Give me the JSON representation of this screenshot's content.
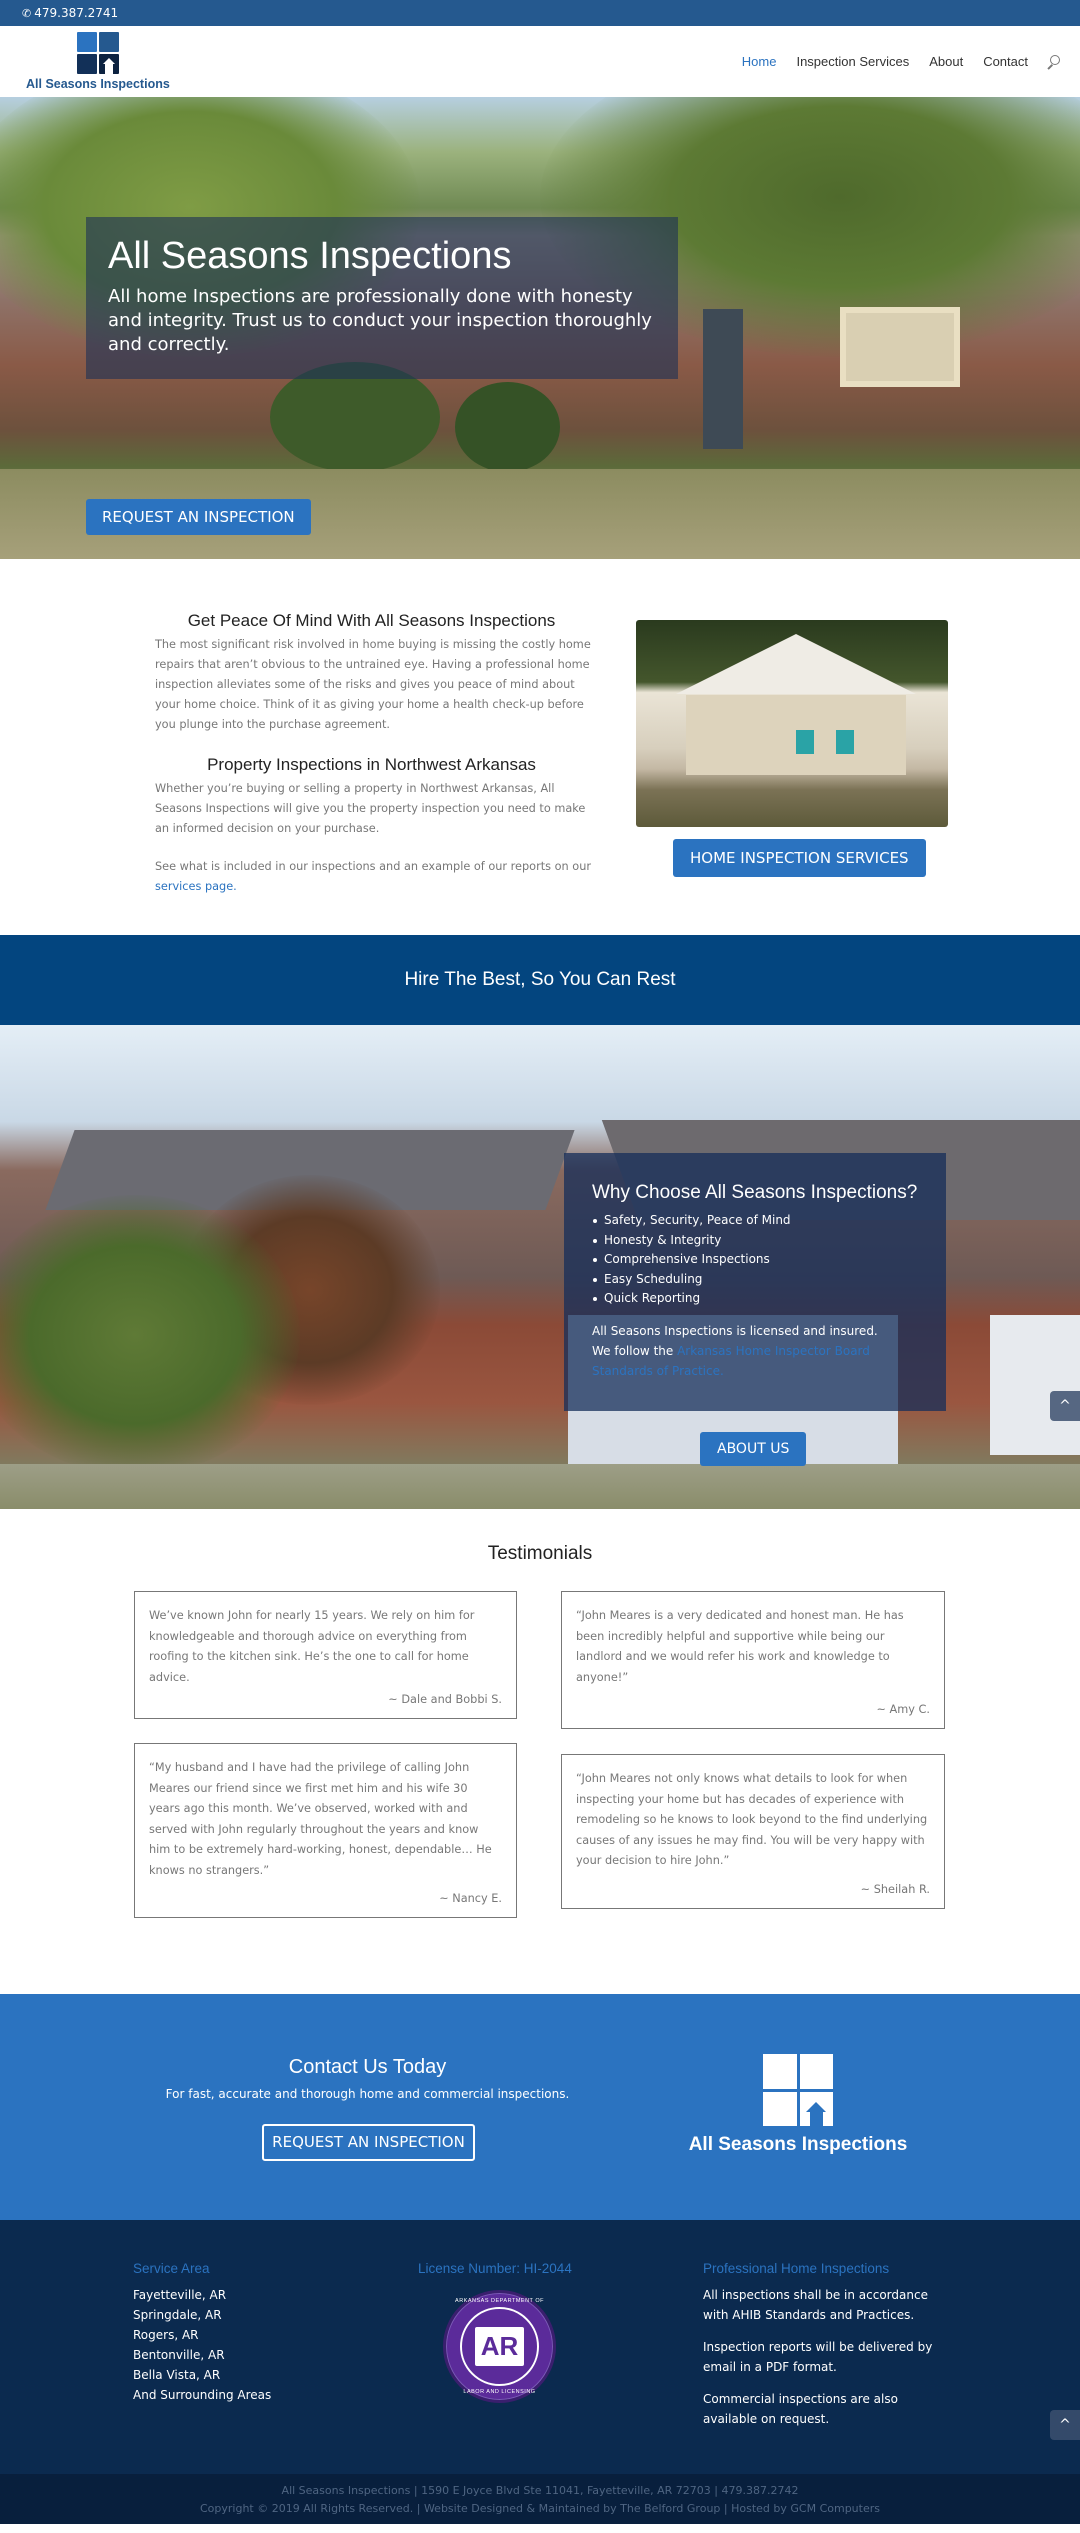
{
  "topbar": {
    "phone_icon": "phone-icon",
    "phone": "479.387.2741"
  },
  "header": {
    "logo_text": "All Seasons Inspections",
    "nav": [
      {
        "label": "Home",
        "active": true
      },
      {
        "label": "Inspection Services",
        "active": false
      },
      {
        "label": "About",
        "active": false
      },
      {
        "label": "Contact",
        "active": false
      }
    ],
    "search_icon": "search-icon"
  },
  "hero": {
    "title": "All Seasons Inspections",
    "subtitle": "All home Inspections are professionally done with honesty and integrity. Trust us to conduct your inspection thoroughly and correctly.",
    "cta": "REQUEST AN INSPECTION"
  },
  "intro": {
    "heading1": "Get Peace Of Mind With All Seasons Inspections",
    "para1": "The most significant risk involved in home buying is missing the costly home repairs that aren’t obvious to the untrained eye. Having a professional home inspection alleviates some of the risks and gives you peace of mind about your home choice. Think of it as giving your home a health check-up before you plunge into the purchase agreement.",
    "heading2": "Property Inspections in Northwest Arkansas",
    "para2": "Whether you’re buying or selling a property in Northwest Arkansas, All Seasons Inspections will give you the property inspection you need to make an informed decision on your purchase.",
    "para3_prefix": "See what is included in our inspections and an example of our reports on our ",
    "para3_link": "services page.",
    "services_button": "HOME INSPECTION SERVICES"
  },
  "band": {
    "text": "Hire The Best, So You Can Rest"
  },
  "why": {
    "title": "Why Choose All Seasons Inspections?",
    "items": [
      "Safety, Security, Peace of Mind",
      "Honesty & Integrity",
      "Comprehensive Inspections",
      "Easy Scheduling",
      "Quick Reporting"
    ],
    "licensed": "All Seasons Inspections is licensed and insured.",
    "follow_prefix": "We follow the ",
    "follow_link": "Arkansas Home Inspector Board Standards of Practice.",
    "about_button": "ABOUT US"
  },
  "scroll_top_label": "^",
  "testimonials": {
    "title": "Testimonials",
    "items": [
      {
        "quote": "We’ve known John for  nearly 15 years. We rely on him for knowledgeable and thorough advice on everything from roofing to the kitchen sink. He’s the one to call for home advice.",
        "author": "~ Dale and Bobbi S."
      },
      {
        "quote": "“John Meares is a very dedicated and honest man. He has been incredibly helpful and supportive while being our landlord and we would refer his work and knowledge to anyone!”",
        "author": "~ Amy C."
      },
      {
        "quote": "“My husband and I have had the privilege of calling John Meares our friend since we first met him and his wife 30 years ago this month. We’ve observed, worked with and served with John regularly throughout the years and know him to be extremely hard-working, honest, dependable… He knows no strangers.”",
        "author": "~ Nancy E."
      },
      {
        "quote": "“John Meares not only knows what details to look for when inspecting your home but has decades of experience with remodeling so he knows to look beyond to the find underlying causes of any issues he may find.  You will be very happy with your decision to hire John.”",
        "author": "~ Sheilah R."
      }
    ]
  },
  "contact": {
    "title": "Contact Us Today",
    "subtitle": "For fast, accurate and thorough home and commercial inspections.",
    "button": "REQUEST AN INSPECTION",
    "logo_text": "All Seasons Inspections"
  },
  "footer": {
    "service_area": {
      "title": "Service Area",
      "items": [
        "Fayetteville, AR",
        "Springdale, AR",
        "Rogers, AR",
        "Bentonville, AR",
        "Bella Vista, AR",
        "And Surrounding Areas"
      ]
    },
    "license": {
      "title": "License Number: HI-2044",
      "seal_top": "ARKANSAS DEPARTMENT OF",
      "seal_center": "AR",
      "seal_bottom": "LABOR AND LICENSING"
    },
    "professional": {
      "title": "Professional Home Inspections",
      "paragraphs": [
        "All inspections shall be in accordance with AHIB Standards and Practices.",
        "Inspection reports will be delivered by email in a PDF format.",
        "Commercial inspections are also available on request."
      ]
    },
    "bottom_line1": "All Seasons Inspections | 1590 E Joyce Blvd Ste 11041, Fayetteville, AR 72703 | 479.387.2742",
    "bottom_line2": "Copyright © 2019 All Rights Reserved. | Website Designed & Maintained by The Belford Group | Hosted by GCM Computers"
  }
}
